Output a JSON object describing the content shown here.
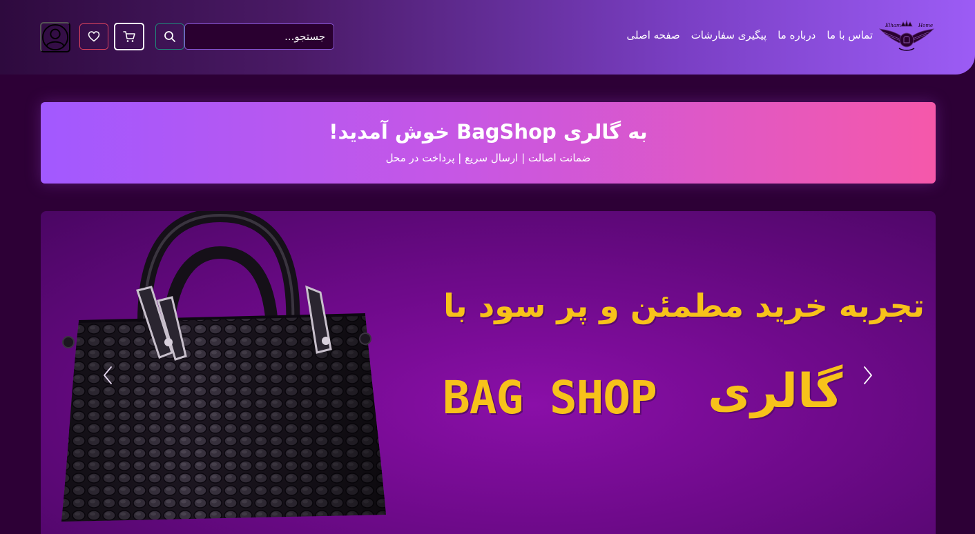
{
  "header": {
    "nav": [
      {
        "label": "صفحه اصلی"
      },
      {
        "label": "پیگیری سفارشات"
      },
      {
        "label": "درباره ما"
      },
      {
        "label": "تماس با ما"
      }
    ],
    "search": {
      "placeholder": "جستجو..."
    },
    "icons": {
      "logo": "crown-wings-logo",
      "search": "search-icon",
      "cart": "cart-icon",
      "wishlist": "heart-icon",
      "account": "user-icon"
    }
  },
  "welcome": {
    "title": "به گالری BagShop خوش آمدید!",
    "subtitle": "ضمانت اصالت | ارسال سریع | پرداخت در محل"
  },
  "carousel": {
    "slide": {
      "headline": "تجربه خرید مطمئن و پر سود با",
      "brand": "BAG SHOP",
      "gallery_word": "گالری"
    },
    "icons": {
      "prev": "chevron-left-icon",
      "next": "chevron-right-icon"
    }
  },
  "colors": {
    "page_background": "#2d0036",
    "header_gradient_start": "#2e0a3e",
    "header_gradient_end": "#9c5cf5",
    "banner_gradient_start": "#a259ff",
    "banner_gradient_end": "#f558aa",
    "slide_text": "#f7c21a",
    "slide_background": "#6e0a8a"
  }
}
